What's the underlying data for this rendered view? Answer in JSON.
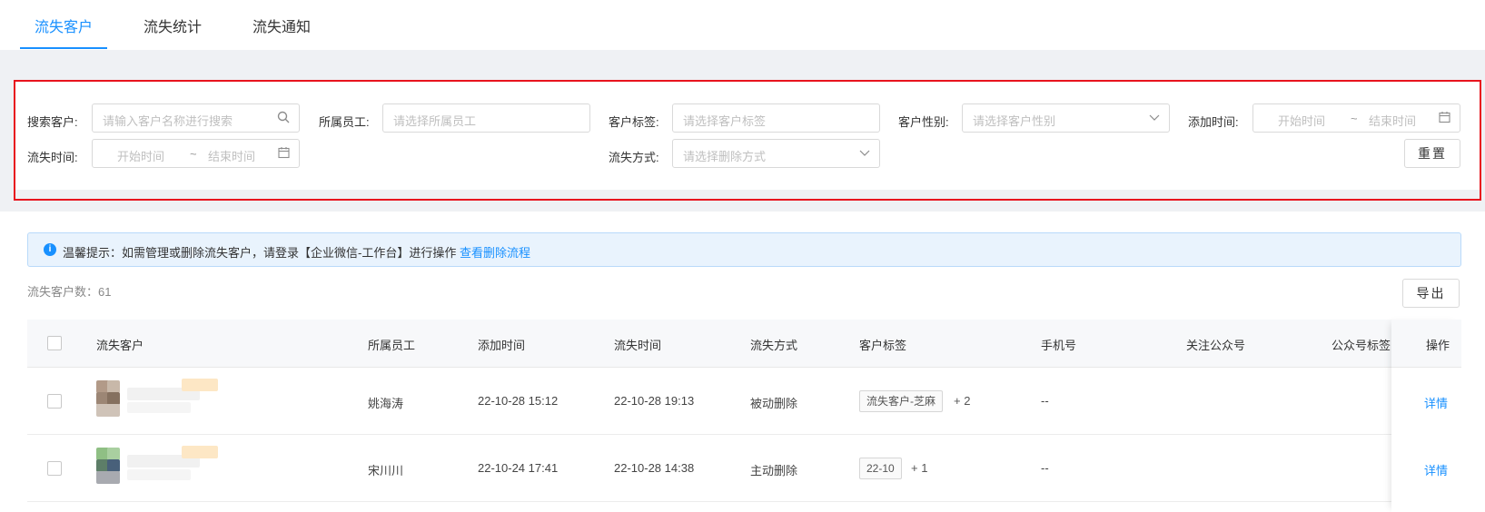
{
  "tabs": [
    {
      "label": "流失客户",
      "active": true
    },
    {
      "label": "流失统计",
      "active": false
    },
    {
      "label": "流失通知",
      "active": false
    }
  ],
  "filters": {
    "search": {
      "label": "搜索客户:",
      "placeholder": "请输入客户名称进行搜索",
      "icon": "search-icon"
    },
    "employee": {
      "label": "所属员工:",
      "placeholder": "请选择所属员工"
    },
    "tag": {
      "label": "客户标签:",
      "placeholder": "请选择客户标签"
    },
    "gender": {
      "label": "客户性别:",
      "placeholder": "请选择客户性别",
      "icon": "chevron-down-icon"
    },
    "add_time": {
      "label": "添加时间:",
      "start": "开始时间",
      "sep": "~",
      "end": "结束时间",
      "icon": "calendar-icon"
    },
    "lost_time": {
      "label": "流失时间:",
      "start": "开始时间",
      "sep": "~",
      "end": "结束时间",
      "icon": "calendar-icon"
    },
    "lost_way": {
      "label": "流失方式:",
      "placeholder": "请选择删除方式",
      "icon": "chevron-down-icon"
    },
    "reset_label": "重置"
  },
  "notice": {
    "text": "温馨提示：如需管理或删除流失客户，请登录【企业微信-工作台】进行操作",
    "link": "查看删除流程"
  },
  "count_text": "流失客户数：61",
  "export_label": "导出",
  "table": {
    "headers": [
      "流失客户",
      "所属员工",
      "添加时间",
      "流失时间",
      "流失方式",
      "客户标签",
      "手机号",
      "关注公众号",
      "公众号标签",
      "操作"
    ],
    "rows": [
      {
        "employee": "姚海涛",
        "add_time": "22-10-28 15:12",
        "lost_time": "22-10-28 19:13",
        "lost_way": "被动删除",
        "tag": "流失客户-芝麻",
        "tag_more": "+ 2",
        "phone": "--",
        "action": "详情"
      },
      {
        "employee": "宋川川",
        "add_time": "22-10-24 17:41",
        "lost_time": "22-10-28 14:38",
        "lost_way": "主动删除",
        "tag": "22-10",
        "tag_more": "+ 1",
        "phone": "--",
        "action": "详情"
      }
    ]
  },
  "colors": {
    "accent": "#1890ff",
    "highlight_border": "#e8141e"
  }
}
